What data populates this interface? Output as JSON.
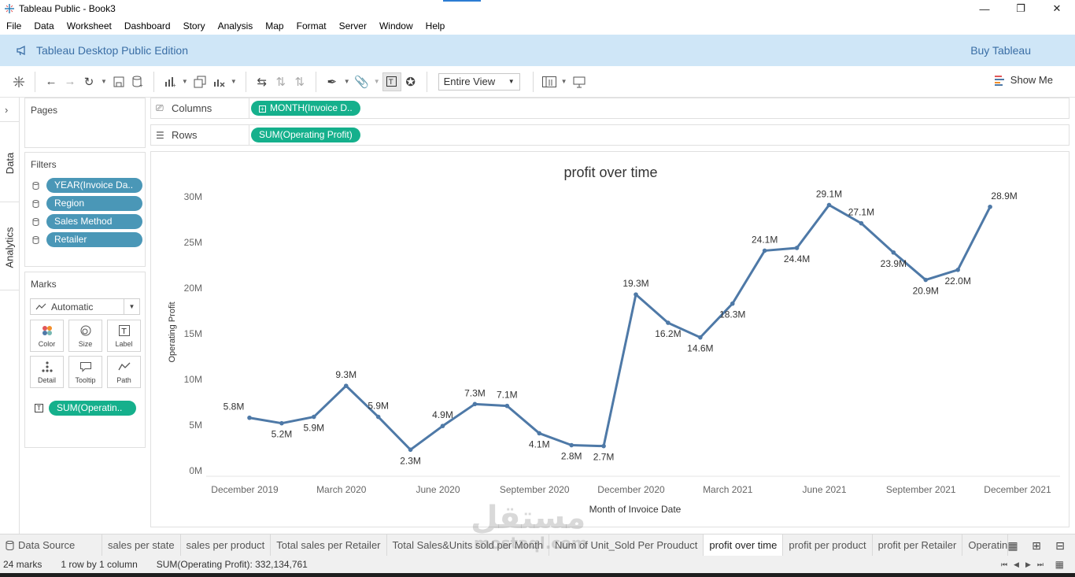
{
  "window": {
    "title": "Tableau Public - Book3"
  },
  "menu": [
    "File",
    "Data",
    "Worksheet",
    "Dashboard",
    "Story",
    "Analysis",
    "Map",
    "Format",
    "Server",
    "Window",
    "Help"
  ],
  "banner": {
    "edition": "Tableau Desktop Public Edition",
    "buy": "Buy Tableau"
  },
  "toolbar": {
    "fit": "Entire View",
    "show_me": "Show Me"
  },
  "side_tabs": {
    "data": "Data",
    "analytics": "Analytics"
  },
  "pages": {
    "title": "Pages"
  },
  "filters": {
    "title": "Filters",
    "items": [
      "YEAR(Invoice Da..",
      "Region",
      "Sales Method",
      "Retailer"
    ]
  },
  "marks": {
    "title": "Marks",
    "type": "Automatic",
    "buttons": [
      "Color",
      "Size",
      "Label",
      "Detail",
      "Tooltip",
      "Path"
    ],
    "field": "SUM(Operatin.."
  },
  "shelves": {
    "columns_label": "Columns",
    "columns_pill": "MONTH(Invoice D..",
    "rows_label": "Rows",
    "rows_pill": "SUM(Operating Profit)"
  },
  "chart_data": {
    "type": "line",
    "title": "profit over time",
    "xlabel": "Month of Invoice Date",
    "ylabel": "Operating Profit",
    "color": "#4e79a7",
    "grid": false,
    "x": [
      "Dec 2019",
      "Jan 2020",
      "Feb 2020",
      "Mar 2020",
      "Apr 2020",
      "May 2020",
      "Jun 2020",
      "Jul 2020",
      "Aug 2020",
      "Sep 2020",
      "Oct 2020",
      "Nov 2020",
      "Dec 2020",
      "Jan 2021",
      "Feb 2021",
      "Mar 2021",
      "Apr 2021",
      "May 2021",
      "Jun 2021",
      "Jul 2021",
      "Aug 2021",
      "Sep 2021",
      "Oct 2021",
      "Nov 2021",
      "Dec 2021"
    ],
    "values": [
      5.8,
      5.2,
      5.9,
      9.3,
      5.9,
      2.3,
      4.9,
      7.3,
      7.1,
      4.1,
      2.8,
      2.7,
      19.3,
      16.2,
      14.6,
      18.3,
      24.1,
      24.4,
      29.1,
      27.1,
      23.9,
      20.9,
      22.0,
      28.9
    ],
    "data_labels": [
      "5.8M",
      "5.2M",
      "5.9M",
      "9.3M",
      "5.9M",
      "2.3M",
      "4.9M",
      "7.3M",
      "7.1M",
      "4.1M",
      "2.8M",
      "2.7M",
      "19.3M",
      "16.2M",
      "14.6M",
      "18.3M",
      "24.1M",
      "24.4M",
      "29.1M",
      "27.1M",
      "23.9M",
      "20.9M",
      "22.0M",
      "28.9M"
    ],
    "x_tick_labels": [
      "December 2019",
      "March 2020",
      "June 2020",
      "September 2020",
      "December 2020",
      "March 2021",
      "June 2021",
      "September 2021",
      "December 2021"
    ],
    "y_tick_labels": [
      "0M",
      "5M",
      "10M",
      "15M",
      "20M",
      "25M",
      "30M"
    ],
    "ylim": [
      0,
      30
    ]
  },
  "sheet_tabs": {
    "data_source": "Data Source",
    "tabs": [
      "sales per state",
      "sales per product",
      "Total sales per Retailer",
      "Total Sales&Units sold per Month",
      "Num of Unit_Sold Per Prouduct",
      "profit over time",
      "profit per product",
      "profit per Retailer",
      "Operating"
    ],
    "active": "profit over time"
  },
  "status": {
    "marks": "24 marks",
    "rows_cols": "1 row by 1 column",
    "sum": "SUM(Operating Profit): 332,134,761"
  },
  "watermark": {
    "arabic": "مستقل",
    "latin": "mostaql.com"
  }
}
